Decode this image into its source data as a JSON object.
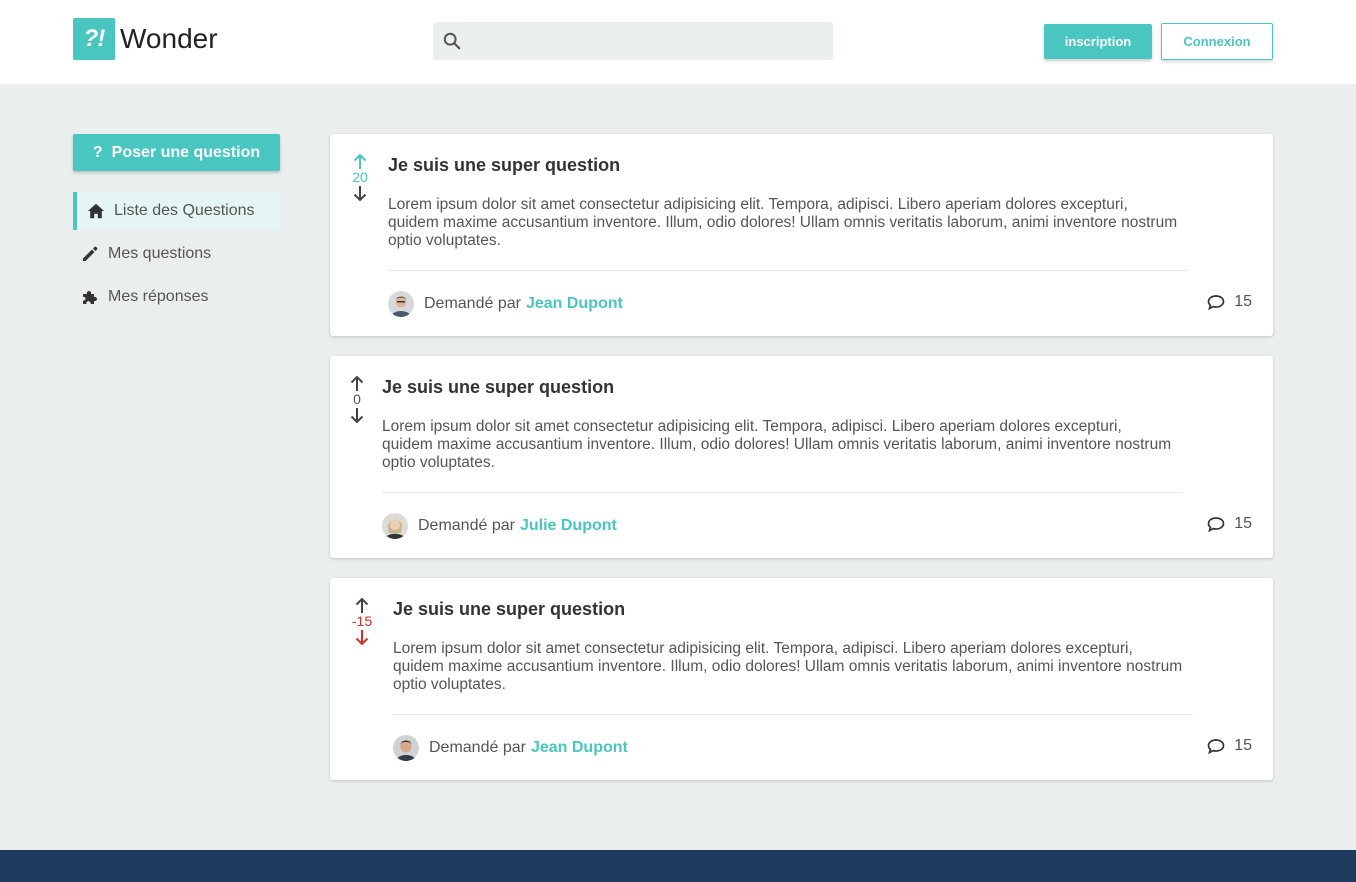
{
  "header": {
    "logo_mark": "?!",
    "logo_text": "Wonder",
    "search_placeholder": "",
    "signup_label": "inscription",
    "login_label": "Connexion"
  },
  "sidebar": {
    "ask_label": "Poser une question",
    "items": [
      {
        "label": "Liste des Questions",
        "icon": "home-icon",
        "active": true
      },
      {
        "label": "Mes questions",
        "icon": "pencil-icon",
        "active": false
      },
      {
        "label": "Mes réponses",
        "icon": "puzzle-icon",
        "active": false
      }
    ]
  },
  "questions": [
    {
      "title": "Je suis une super question",
      "body": "Lorem ipsum dolor sit amet consectetur adipisicing elit. Tempora, adipisci. Libero aperiam dolores excepturi, quidem maxime accusantium inventore. Illum, odio dolores! Ullam omnis veritatis laborum, animi inventore nostrum optio voluptates.",
      "score": "20",
      "asked_by_prefix": "Demandé par",
      "author": "Jean Dupont",
      "comments": "15"
    },
    {
      "title": "Je suis une super question",
      "body": "Lorem ipsum dolor sit amet consectetur adipisicing elit. Tempora, adipisci. Libero aperiam dolores excepturi, quidem maxime accusantium inventore. Illum, odio dolores! Ullam omnis veritatis laborum, animi inventore nostrum optio voluptates.",
      "score": "0",
      "asked_by_prefix": "Demandé par",
      "author": "Julie Dupont",
      "comments": "15"
    },
    {
      "title": "Je suis une super question",
      "body": "Lorem ipsum dolor sit amet consectetur adipisicing elit. Tempora, adipisci. Libero aperiam dolores excepturi, quidem maxime accusantium inventore. Illum, odio dolores! Ullam omnis veritatis laborum, animi inventore nostrum optio voluptates.",
      "score": "-15",
      "asked_by_prefix": "Demandé par",
      "author": "Jean Dupont",
      "comments": "15"
    }
  ],
  "colors": {
    "accent": "#49c6c0",
    "negative": "#d0312d",
    "neutral": "#555555",
    "footer": "#1e3a5f",
    "background": "#ebeeef"
  }
}
